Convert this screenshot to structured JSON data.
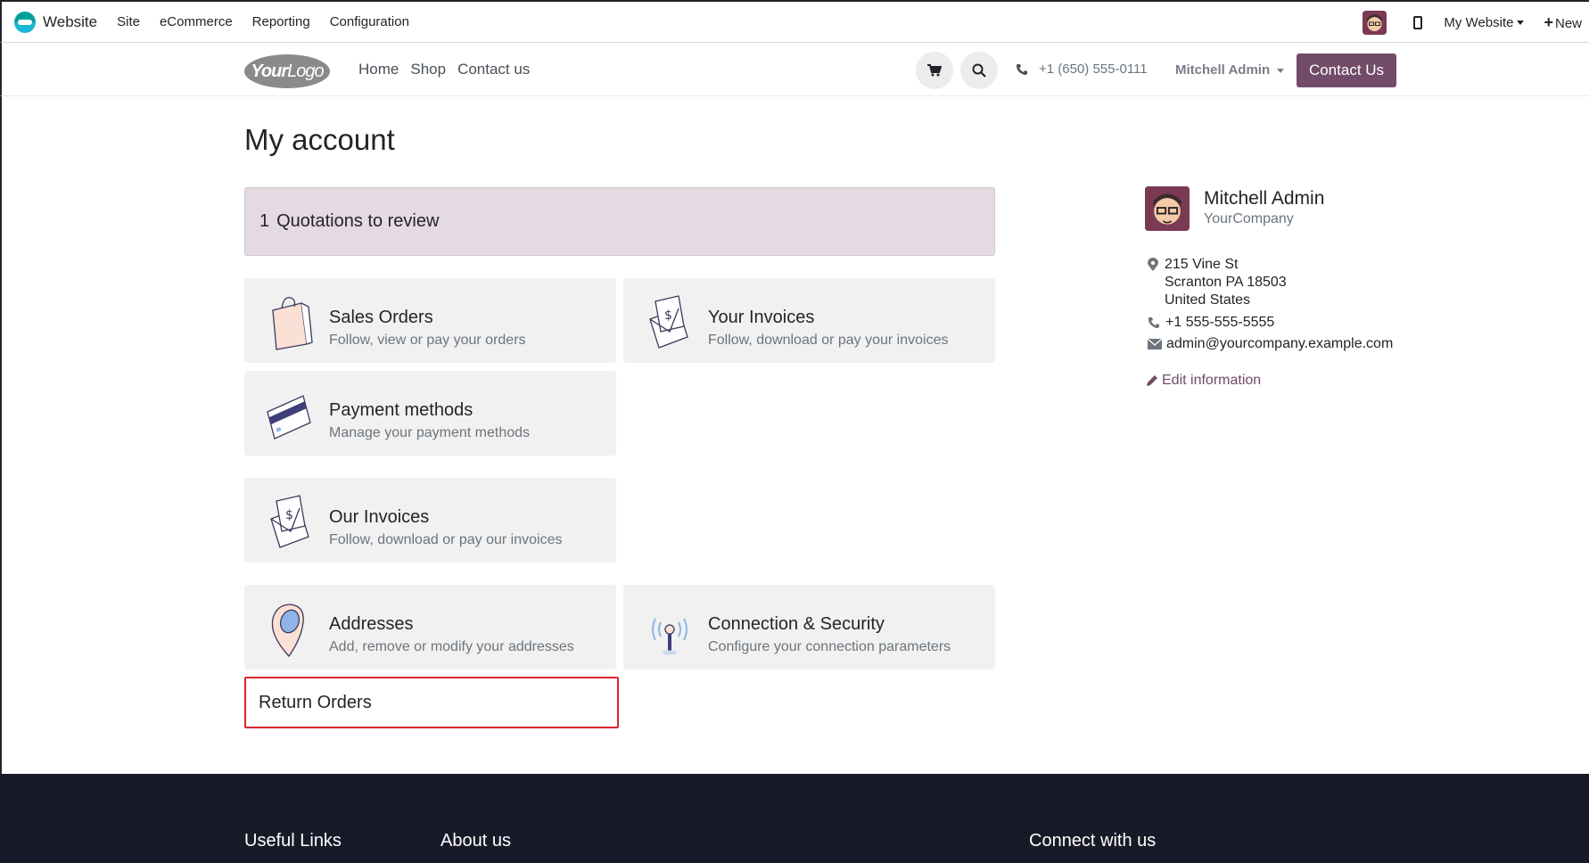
{
  "admin_bar": {
    "brand": "Website",
    "menu": [
      "Site",
      "eCommerce",
      "Reporting",
      "Configuration"
    ],
    "site_select": "My Website",
    "new_label": "New"
  },
  "header": {
    "nav": [
      "Home",
      "Shop",
      "Contact us"
    ],
    "phone": "+1 (650) 555-0111",
    "user": "Mitchell Admin",
    "contact_button": "Contact Us"
  },
  "main": {
    "title": "My account",
    "alert_count": "1",
    "alert_text": "Quotations to review",
    "cards": [
      {
        "title": "Sales Orders",
        "subtitle": "Follow, view or pay your orders",
        "icon": "shopping-bag-icon"
      },
      {
        "title": "Your Invoices",
        "subtitle": "Follow, download or pay your invoices",
        "icon": "invoice-envelope-icon"
      },
      {
        "title": "Payment methods",
        "subtitle": "Manage your payment methods",
        "icon": "credit-card-icon"
      },
      {
        "title": "Our Invoices",
        "subtitle": "Follow, download or pay our invoices",
        "icon": "invoice-envelope-icon"
      },
      {
        "title": "Addresses",
        "subtitle": "Add, remove or modify your addresses",
        "icon": "map-pin-icon"
      },
      {
        "title": "Connection & Security",
        "subtitle": "Configure your connection parameters",
        "icon": "antenna-icon"
      }
    ],
    "return_orders": "Return Orders"
  },
  "sidebar": {
    "name": "Mitchell Admin",
    "company": "YourCompany",
    "address_lines": [
      "215 Vine St",
      "Scranton PA 18503",
      "United States"
    ],
    "phone": "+1 555-555-5555",
    "email": "admin@yourcompany.example.com",
    "edit_label": "Edit information"
  },
  "footer": {
    "columns": [
      "Useful Links",
      "About us",
      "Connect with us"
    ]
  },
  "colors": {
    "brand_primary": "#714b67",
    "alert_bg": "#e6dae2",
    "highlight_border": "#d9262e",
    "footer_bg": "#191a29"
  }
}
